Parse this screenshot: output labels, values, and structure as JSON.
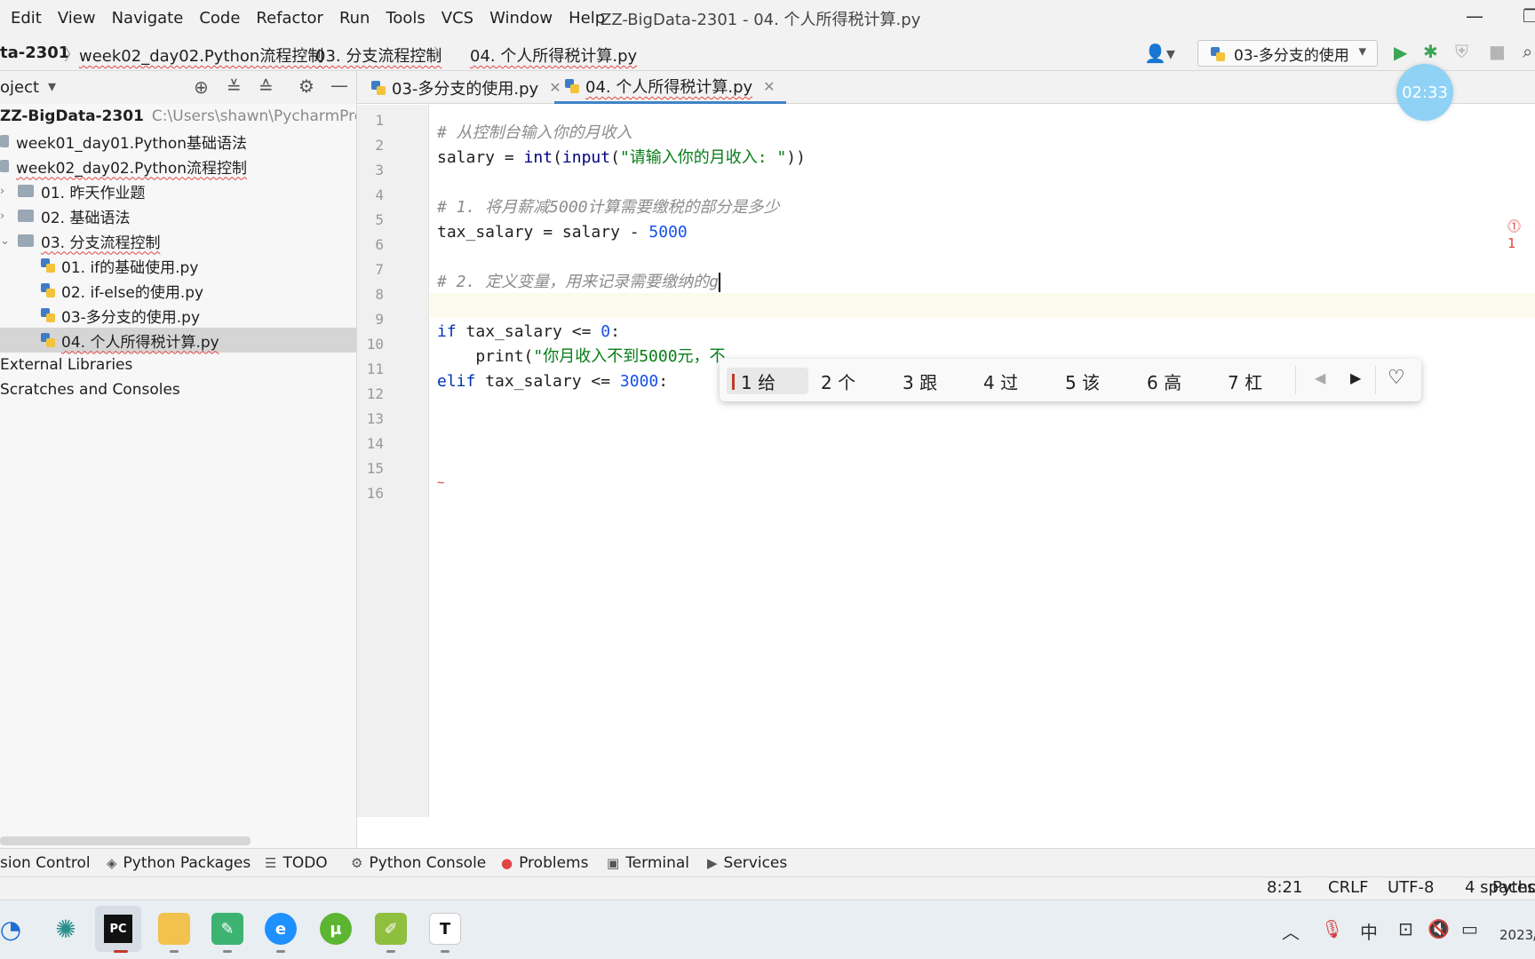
{
  "menu": [
    "Edit",
    "View",
    "Navigate",
    "Code",
    "Refactor",
    "Run",
    "Tools",
    "VCS",
    "Window",
    "Help"
  ],
  "window_title": "ZZ-BigData-2301 - 04. 个人所得税计算.py",
  "breadcrumb": {
    "project": "ta-2301",
    "c1": "week02_day02.Python流程控制",
    "c2": "03. 分支流程控制",
    "c3": "04. 个人所得税计算.py"
  },
  "run_config": "03-多分支的使用",
  "project_panel": {
    "title": "oject",
    "root_name": "ZZ-BigData-2301",
    "root_path": "C:\\Users\\shawn\\PycharmProject",
    "items": [
      "week01_day01.Python基础语法",
      "week02_day02.Python流程控制",
      "01. 昨天作业题",
      "02. 基础语法",
      "03. 分支流程控制",
      "01. if的基础使用.py",
      "02. if-else的使用.py",
      "03-多分支的使用.py",
      "04. 个人所得税计算.py",
      "External Libraries",
      "Scratches and Consoles"
    ]
  },
  "tabs": [
    "03-多分支的使用.py",
    "04. 个人所得税计算.py"
  ],
  "line_numbers": [
    "1",
    "2",
    "3",
    "4",
    "5",
    "6",
    "7",
    "8",
    "9",
    "10",
    "11",
    "12",
    "13",
    "14",
    "15",
    "16"
  ],
  "code": {
    "l2": "# 从控制台输入你的月收入",
    "l3_a": "salary = ",
    "l3_b": "int",
    "l3_c": "(",
    "l3_d": "input",
    "l3_e": "(",
    "l3_f": "\"请输入你的月收入: \"",
    "l3_g": "))",
    "l5": "# 1. 将月薪减5000计算需要缴税的部分是多少",
    "l6_a": "tax_salary = salary - ",
    "l6_b": "5000",
    "l8_a": "# 2. 定义变量，用来记录需要缴纳的",
    "l8_b": "g",
    "l10_a": "if",
    "l10_b": " tax_salary <= ",
    "l10_c": "0",
    "l10_d": ":",
    "l11_a": "    print(",
    "l11_b": "\"你月收入不到5000元，不",
    "l12_a": "elif",
    "l12_b": " tax_salary <= ",
    "l12_c": "3000",
    "l12_d": ":"
  },
  "error_count": "1",
  "ime": {
    "candidates": [
      "1 给",
      "2 个",
      "3 跟",
      "4 过",
      "5 该",
      "6 高",
      "7 杠"
    ]
  },
  "timer": "02:33",
  "tool_tabs": [
    "sion Control",
    "Python Packages",
    "TODO",
    "Python Console",
    "Problems",
    "Terminal",
    "Services"
  ],
  "status": {
    "position": "8:21",
    "line_sep": "CRLF",
    "encoding": "UTF-8",
    "indent": "4 spaces",
    "interpreter": "Pytho"
  },
  "taskbar": {
    "tray_ime": "中",
    "date": "2023/"
  },
  "colors": {
    "accent": "#4083c9",
    "keyword": "#0033b3",
    "number": "#1750eb",
    "string": "#067d17",
    "comment": "#8c8c8c",
    "error": "#e04545",
    "timer": "#8fd2f5"
  }
}
